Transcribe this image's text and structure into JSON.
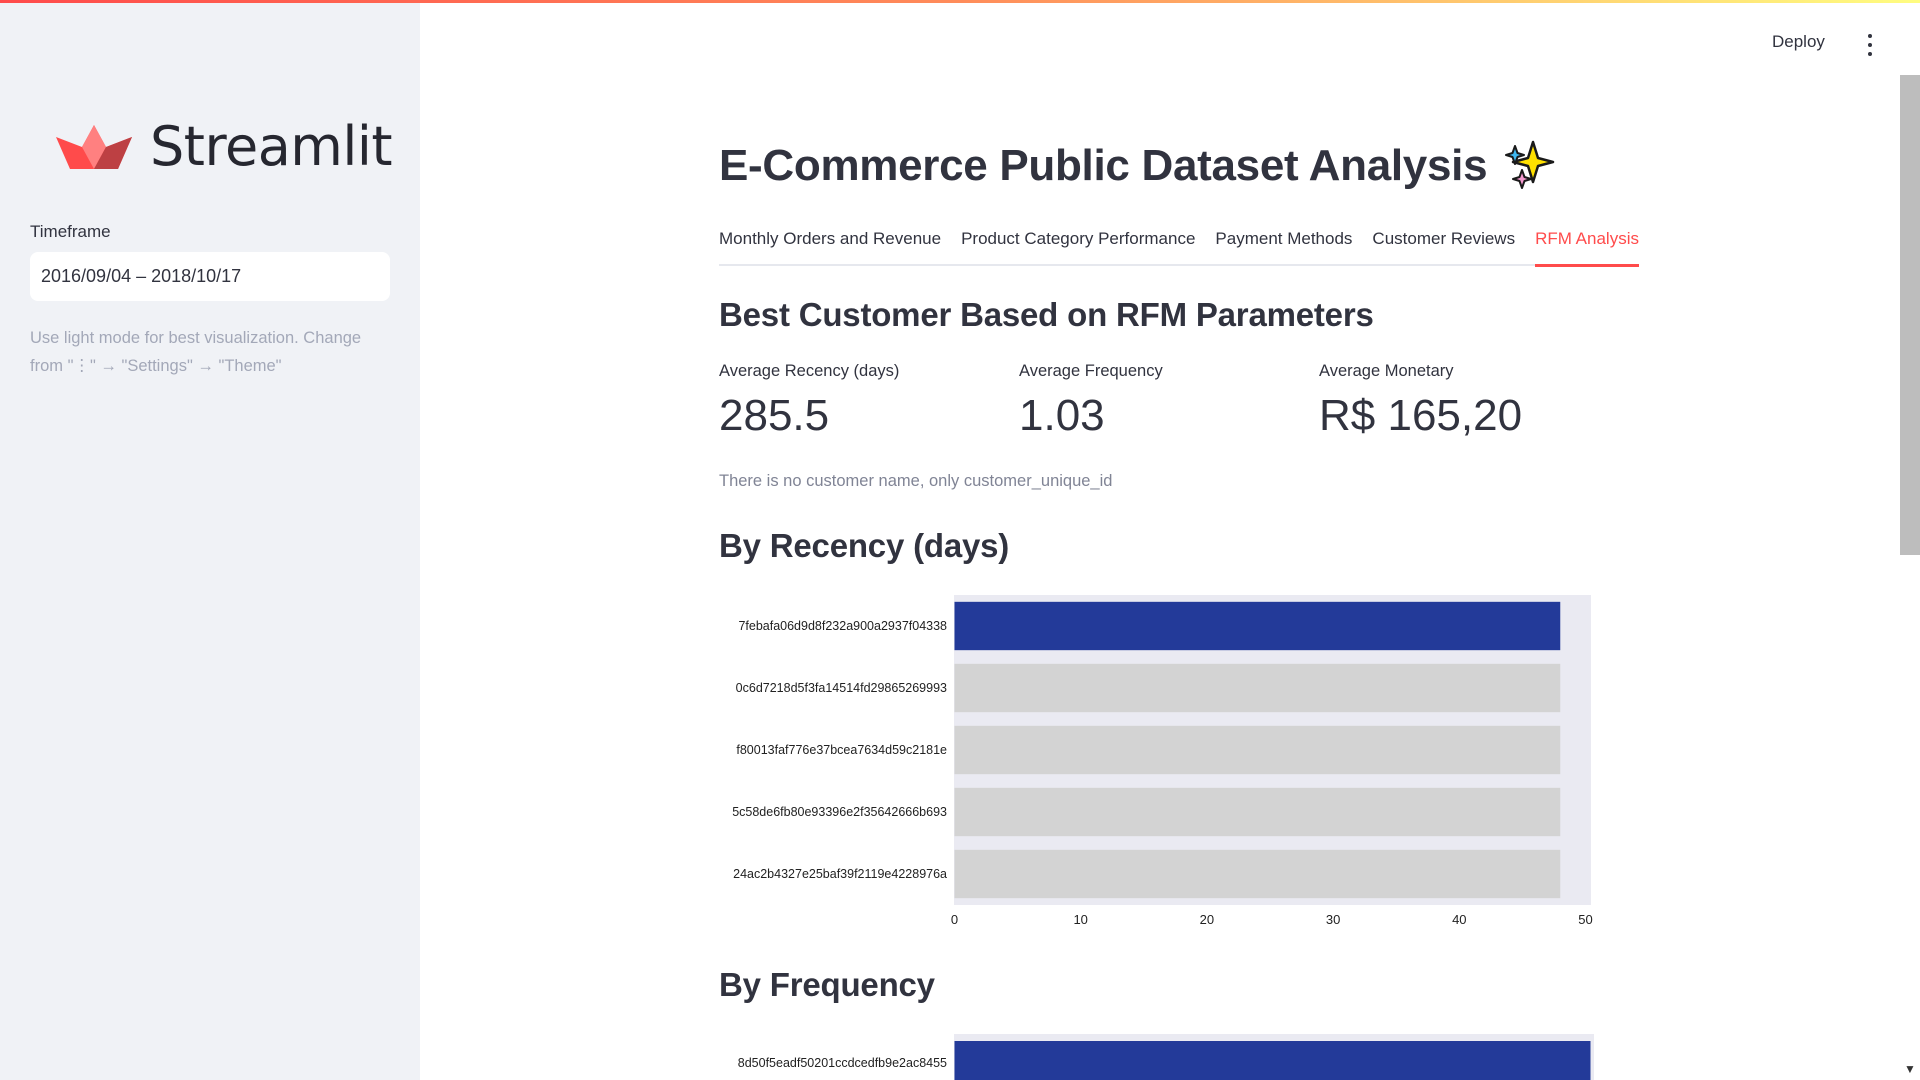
{
  "sidebar": {
    "logo_text": "Streamlit",
    "timeframe_label": "Timeframe",
    "timeframe_value": "2016/09/04 – 2018/10/17",
    "note": "Use light mode for best visualization. Change from \"⋮\" → \"Settings\" → \"Theme\""
  },
  "toolbar": {
    "deploy_label": "Deploy",
    "menu_icon": "kebab-menu-icon"
  },
  "main": {
    "title": "E-Commerce Public Dataset Analysis",
    "title_icon": "sparkles-icon",
    "tabs": [
      {
        "label": "Monthly Orders and Revenue",
        "active": false
      },
      {
        "label": "Product Category Performance",
        "active": false
      },
      {
        "label": "Payment Methods",
        "active": false
      },
      {
        "label": "Customer Reviews",
        "active": false
      },
      {
        "label": "RFM Analysis",
        "active": true
      }
    ],
    "section_title": "Best Customer Based on RFM Parameters",
    "metrics": [
      {
        "label": "Average Recency (days)",
        "value": "285.5"
      },
      {
        "label": "Average Frequency",
        "value": "1.03"
      },
      {
        "label": "Average Monetary",
        "value": "R$ 165,20"
      }
    ],
    "caption": "There is no customer name, only customer_unique_id",
    "recency_heading": "By Recency (days)",
    "frequency_heading": "By Frequency"
  },
  "colors": {
    "accent": "#ff4b4b",
    "bar_highlight": "#233a99",
    "bar_muted": "#d3d3d3",
    "plot_bg": "#eaeaf2"
  },
  "chart_data": [
    {
      "type": "bar",
      "orientation": "horizontal",
      "title": "By Recency (days)",
      "categories": [
        "7febafa06d9d8f232a900a2937f04338",
        "0c6d7218d5f3fa14514fd29865269993",
        "f80013faf776e37bcea7634d59c2181e",
        "5c58de6fb80e93396e2f35642666b693",
        "24ac2b4327e25baf39f2119e4228976a"
      ],
      "values": [
        48,
        48,
        48,
        48,
        48
      ],
      "xlim": [
        0,
        50
      ],
      "xticks": [
        "0",
        "10",
        "20",
        "30",
        "40",
        "50"
      ],
      "highlight_index": 0,
      "grid": false
    },
    {
      "type": "bar",
      "orientation": "horizontal",
      "title": "By Frequency",
      "categories": [
        "8d50f5eadf50201ccdcedfb9e2ac8455"
      ],
      "values_visible": "partially",
      "values": [],
      "highlight_index": 0
    }
  ]
}
